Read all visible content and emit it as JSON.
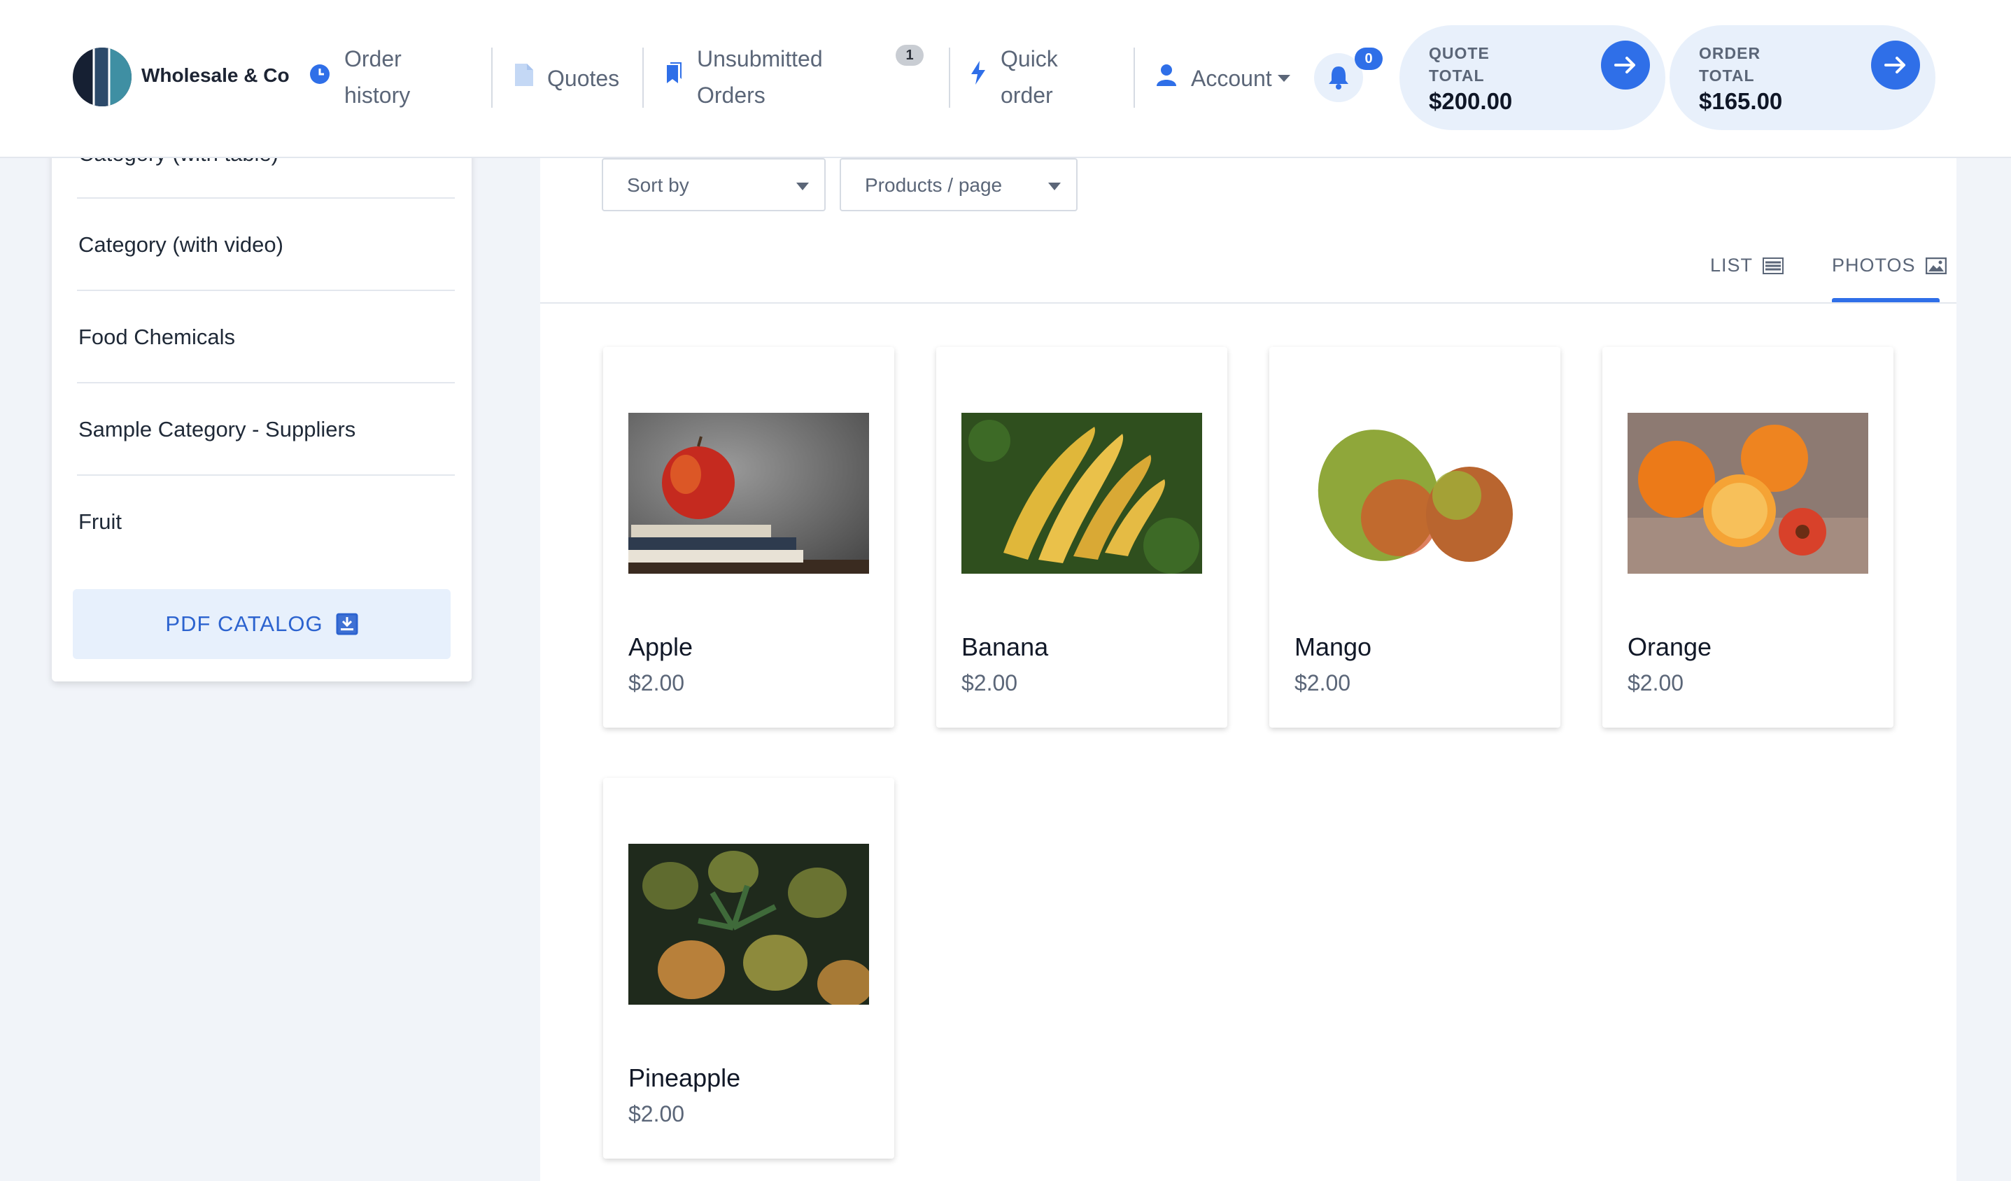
{
  "header": {
    "brand": "Wholesale & Co",
    "nav": {
      "order_history": "Order\nhistory",
      "quotes": "Quotes",
      "unsubmitted_orders": "Unsubmitted\nOrders",
      "unsubmitted_count": "1",
      "quick_order": "Quick\norder",
      "account": "Account"
    },
    "notifications_count": "0",
    "quote_total": {
      "label": "QUOTE\nTOTAL",
      "amount": "$200.00"
    },
    "order_total": {
      "label": "ORDER\nTOTAL",
      "amount": "$165.00"
    }
  },
  "sidebar": {
    "items": [
      {
        "label": "Category (with table)"
      },
      {
        "label": "Category (with video)"
      },
      {
        "label": "Food Chemicals"
      },
      {
        "label": "Sample Category - Suppliers"
      },
      {
        "label": "Fruit"
      }
    ],
    "pdf_button": "PDF CATALOG"
  },
  "toolbar": {
    "sort_by": "Sort by",
    "products_per_page": "Products / page",
    "view_list": "LIST",
    "view_photos": "PHOTOS"
  },
  "products": [
    {
      "name": "Apple",
      "price": "$2.00",
      "image": "apple-on-books-photo"
    },
    {
      "name": "Banana",
      "price": "$2.00",
      "image": "bananas-on-grass-photo"
    },
    {
      "name": "Mango",
      "price": "$2.00",
      "image": "two-mangoes-photo"
    },
    {
      "name": "Orange",
      "price": "$2.00",
      "image": "oranges-with-flower-photo"
    },
    {
      "name": "Pineapple",
      "price": "$2.00",
      "image": "pineapples-photo"
    }
  ],
  "colors": {
    "accent": "#2f6fe8",
    "page_bg": "#f1f4f9",
    "muted_text": "#5b6678"
  }
}
